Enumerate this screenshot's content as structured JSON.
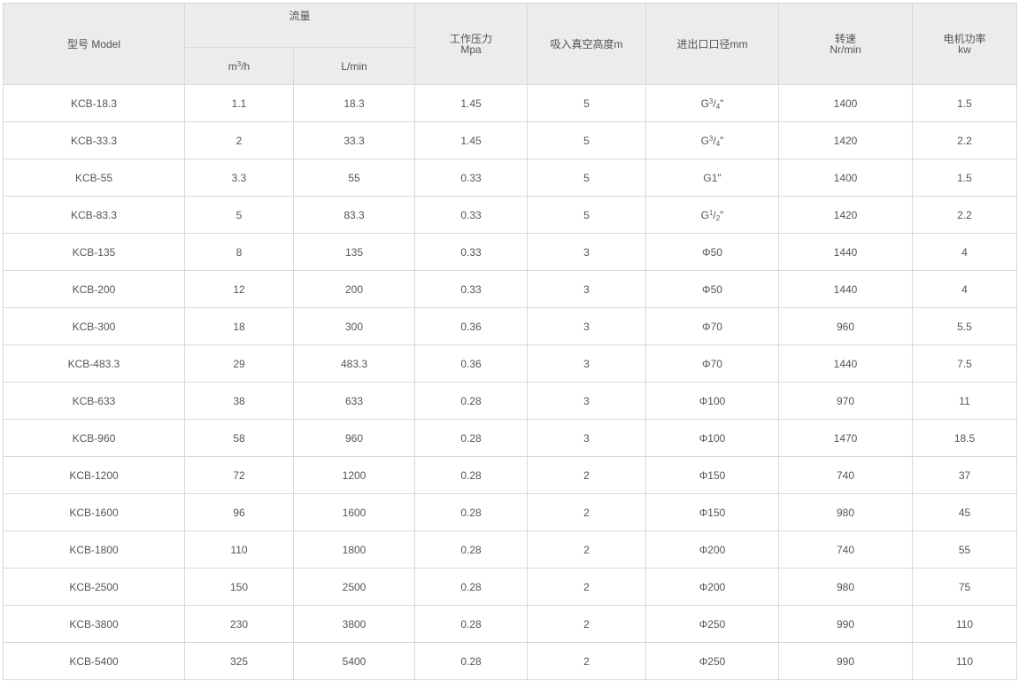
{
  "header": {
    "model": "型号 Model",
    "flow": "流量",
    "flow_m3h_base": "m",
    "flow_m3h_sup": "3",
    "flow_m3h_tail": "/h",
    "flow_lmin": "L/min",
    "pressure_line1": "工作压力",
    "pressure_line2": "Mpa",
    "vacuum": "吸入真空高度m",
    "diameter": "进出口口径mm",
    "speed_line1": "转速",
    "speed_line2": "Nr/min",
    "power_line1": "电机功率",
    "power_line2": "kw"
  },
  "rows": [
    {
      "model": "KCB-18.3",
      "m3h": "1.1",
      "lmin": "18.3",
      "pressure": "1.45",
      "vacuum": "5",
      "dia": {
        "type": "frac",
        "base": "G",
        "num": "3",
        "den": "4",
        "tail": "\""
      },
      "speed": "1400",
      "power": "1.5"
    },
    {
      "model": "KCB-33.3",
      "m3h": "2",
      "lmin": "33.3",
      "pressure": "1.45",
      "vacuum": "5",
      "dia": {
        "type": "frac",
        "base": "G",
        "num": "3",
        "den": "4",
        "tail": "\""
      },
      "speed": "1420",
      "power": "2.2"
    },
    {
      "model": "KCB-55",
      "m3h": "3.3",
      "lmin": "55",
      "pressure": "0.33",
      "vacuum": "5",
      "dia": {
        "type": "text",
        "text": "G1\""
      },
      "speed": "1400",
      "power": "1.5"
    },
    {
      "model": "KCB-83.3",
      "m3h": "5",
      "lmin": "83.3",
      "pressure": "0.33",
      "vacuum": "5",
      "dia": {
        "type": "frac",
        "base": "G",
        "num": "1",
        "den": "2",
        "tail": "\""
      },
      "speed": "1420",
      "power": "2.2"
    },
    {
      "model": "KCB-135",
      "m3h": "8",
      "lmin": "135",
      "pressure": "0.33",
      "vacuum": "3",
      "dia": {
        "type": "text",
        "text": "Φ50"
      },
      "speed": "1440",
      "power": "4"
    },
    {
      "model": "KCB-200",
      "m3h": "12",
      "lmin": "200",
      "pressure": "0.33",
      "vacuum": "3",
      "dia": {
        "type": "text",
        "text": "Φ50"
      },
      "speed": "1440",
      "power": "4"
    },
    {
      "model": "KCB-300",
      "m3h": "18",
      "lmin": "300",
      "pressure": "0.36",
      "vacuum": "3",
      "dia": {
        "type": "text",
        "text": "Φ70"
      },
      "speed": "960",
      "power": "5.5"
    },
    {
      "model": "KCB-483.3",
      "m3h": "29",
      "lmin": "483.3",
      "pressure": "0.36",
      "vacuum": "3",
      "dia": {
        "type": "text",
        "text": "Φ70"
      },
      "speed": "1440",
      "power": "7.5"
    },
    {
      "model": "KCB-633",
      "m3h": "38",
      "lmin": "633",
      "pressure": "0.28",
      "vacuum": "3",
      "dia": {
        "type": "text",
        "text": "Φ100"
      },
      "speed": "970",
      "power": "11"
    },
    {
      "model": "KCB-960",
      "m3h": "58",
      "lmin": "960",
      "pressure": "0.28",
      "vacuum": "3",
      "dia": {
        "type": "text",
        "text": "Φ100"
      },
      "speed": "1470",
      "power": "18.5"
    },
    {
      "model": "KCB-1200",
      "m3h": "72",
      "lmin": "1200",
      "pressure": "0.28",
      "vacuum": "2",
      "dia": {
        "type": "text",
        "text": "Φ150"
      },
      "speed": "740",
      "power": "37"
    },
    {
      "model": "KCB-1600",
      "m3h": "96",
      "lmin": "1600",
      "pressure": "0.28",
      "vacuum": "2",
      "dia": {
        "type": "text",
        "text": "Φ150"
      },
      "speed": "980",
      "power": "45"
    },
    {
      "model": "KCB-1800",
      "m3h": "110",
      "lmin": "1800",
      "pressure": "0.28",
      "vacuum": "2",
      "dia": {
        "type": "text",
        "text": "Φ200"
      },
      "speed": "740",
      "power": "55"
    },
    {
      "model": "KCB-2500",
      "m3h": "150",
      "lmin": "2500",
      "pressure": "0.28",
      "vacuum": "2",
      "dia": {
        "type": "text",
        "text": "Φ200"
      },
      "speed": "980",
      "power": "75"
    },
    {
      "model": "KCB-3800",
      "m3h": "230",
      "lmin": "3800",
      "pressure": "0.28",
      "vacuum": "2",
      "dia": {
        "type": "text",
        "text": "Φ250"
      },
      "speed": "990",
      "power": "110"
    },
    {
      "model": "KCB-5400",
      "m3h": "325",
      "lmin": "5400",
      "pressure": "0.28",
      "vacuum": "2",
      "dia": {
        "type": "text",
        "text": "Φ250"
      },
      "speed": "990",
      "power": "110"
    }
  ],
  "colors": {
    "header_bg": "#ececec",
    "border": "#d9d9d9",
    "text": "#555555"
  }
}
